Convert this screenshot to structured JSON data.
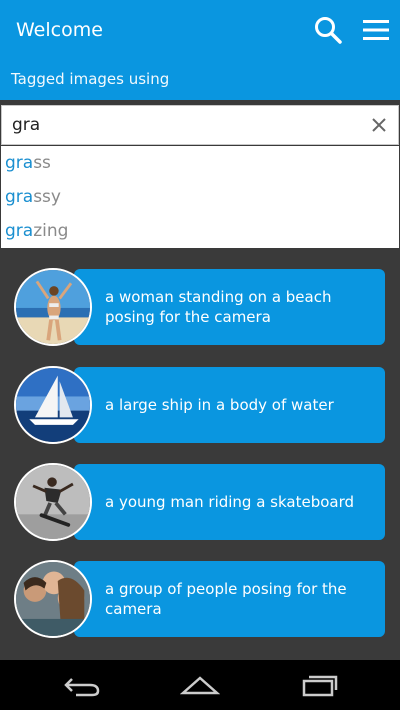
{
  "header": {
    "title": "Welcome",
    "subtitle": "Tagged images using",
    "search_icon": "search-icon",
    "menu_icon": "menu-icon"
  },
  "search": {
    "value": "gra",
    "clear_icon": "close-icon"
  },
  "suggestions": [
    {
      "match": "gra",
      "rest": "ss"
    },
    {
      "match": "gra",
      "rest": "ssy"
    },
    {
      "match": "gra",
      "rest": "zing"
    }
  ],
  "cards": [
    {
      "caption": "a woman standing on a beach posing for the camera",
      "image": "beach-woman-photo"
    },
    {
      "caption": "a large ship in a body of water",
      "image": "sailboat-photo"
    },
    {
      "caption": "a young man riding a skateboard",
      "image": "skateboarder-photo"
    },
    {
      "caption": "a group of people posing for the camera",
      "image": "group-people-photo"
    }
  ],
  "navbar": {
    "back_icon": "back-icon",
    "home_icon": "home-icon",
    "recents_icon": "recents-icon"
  },
  "colors": {
    "accent": "#0a96e0",
    "background": "#3a3a3a",
    "highlight": "#1a8fd0"
  }
}
